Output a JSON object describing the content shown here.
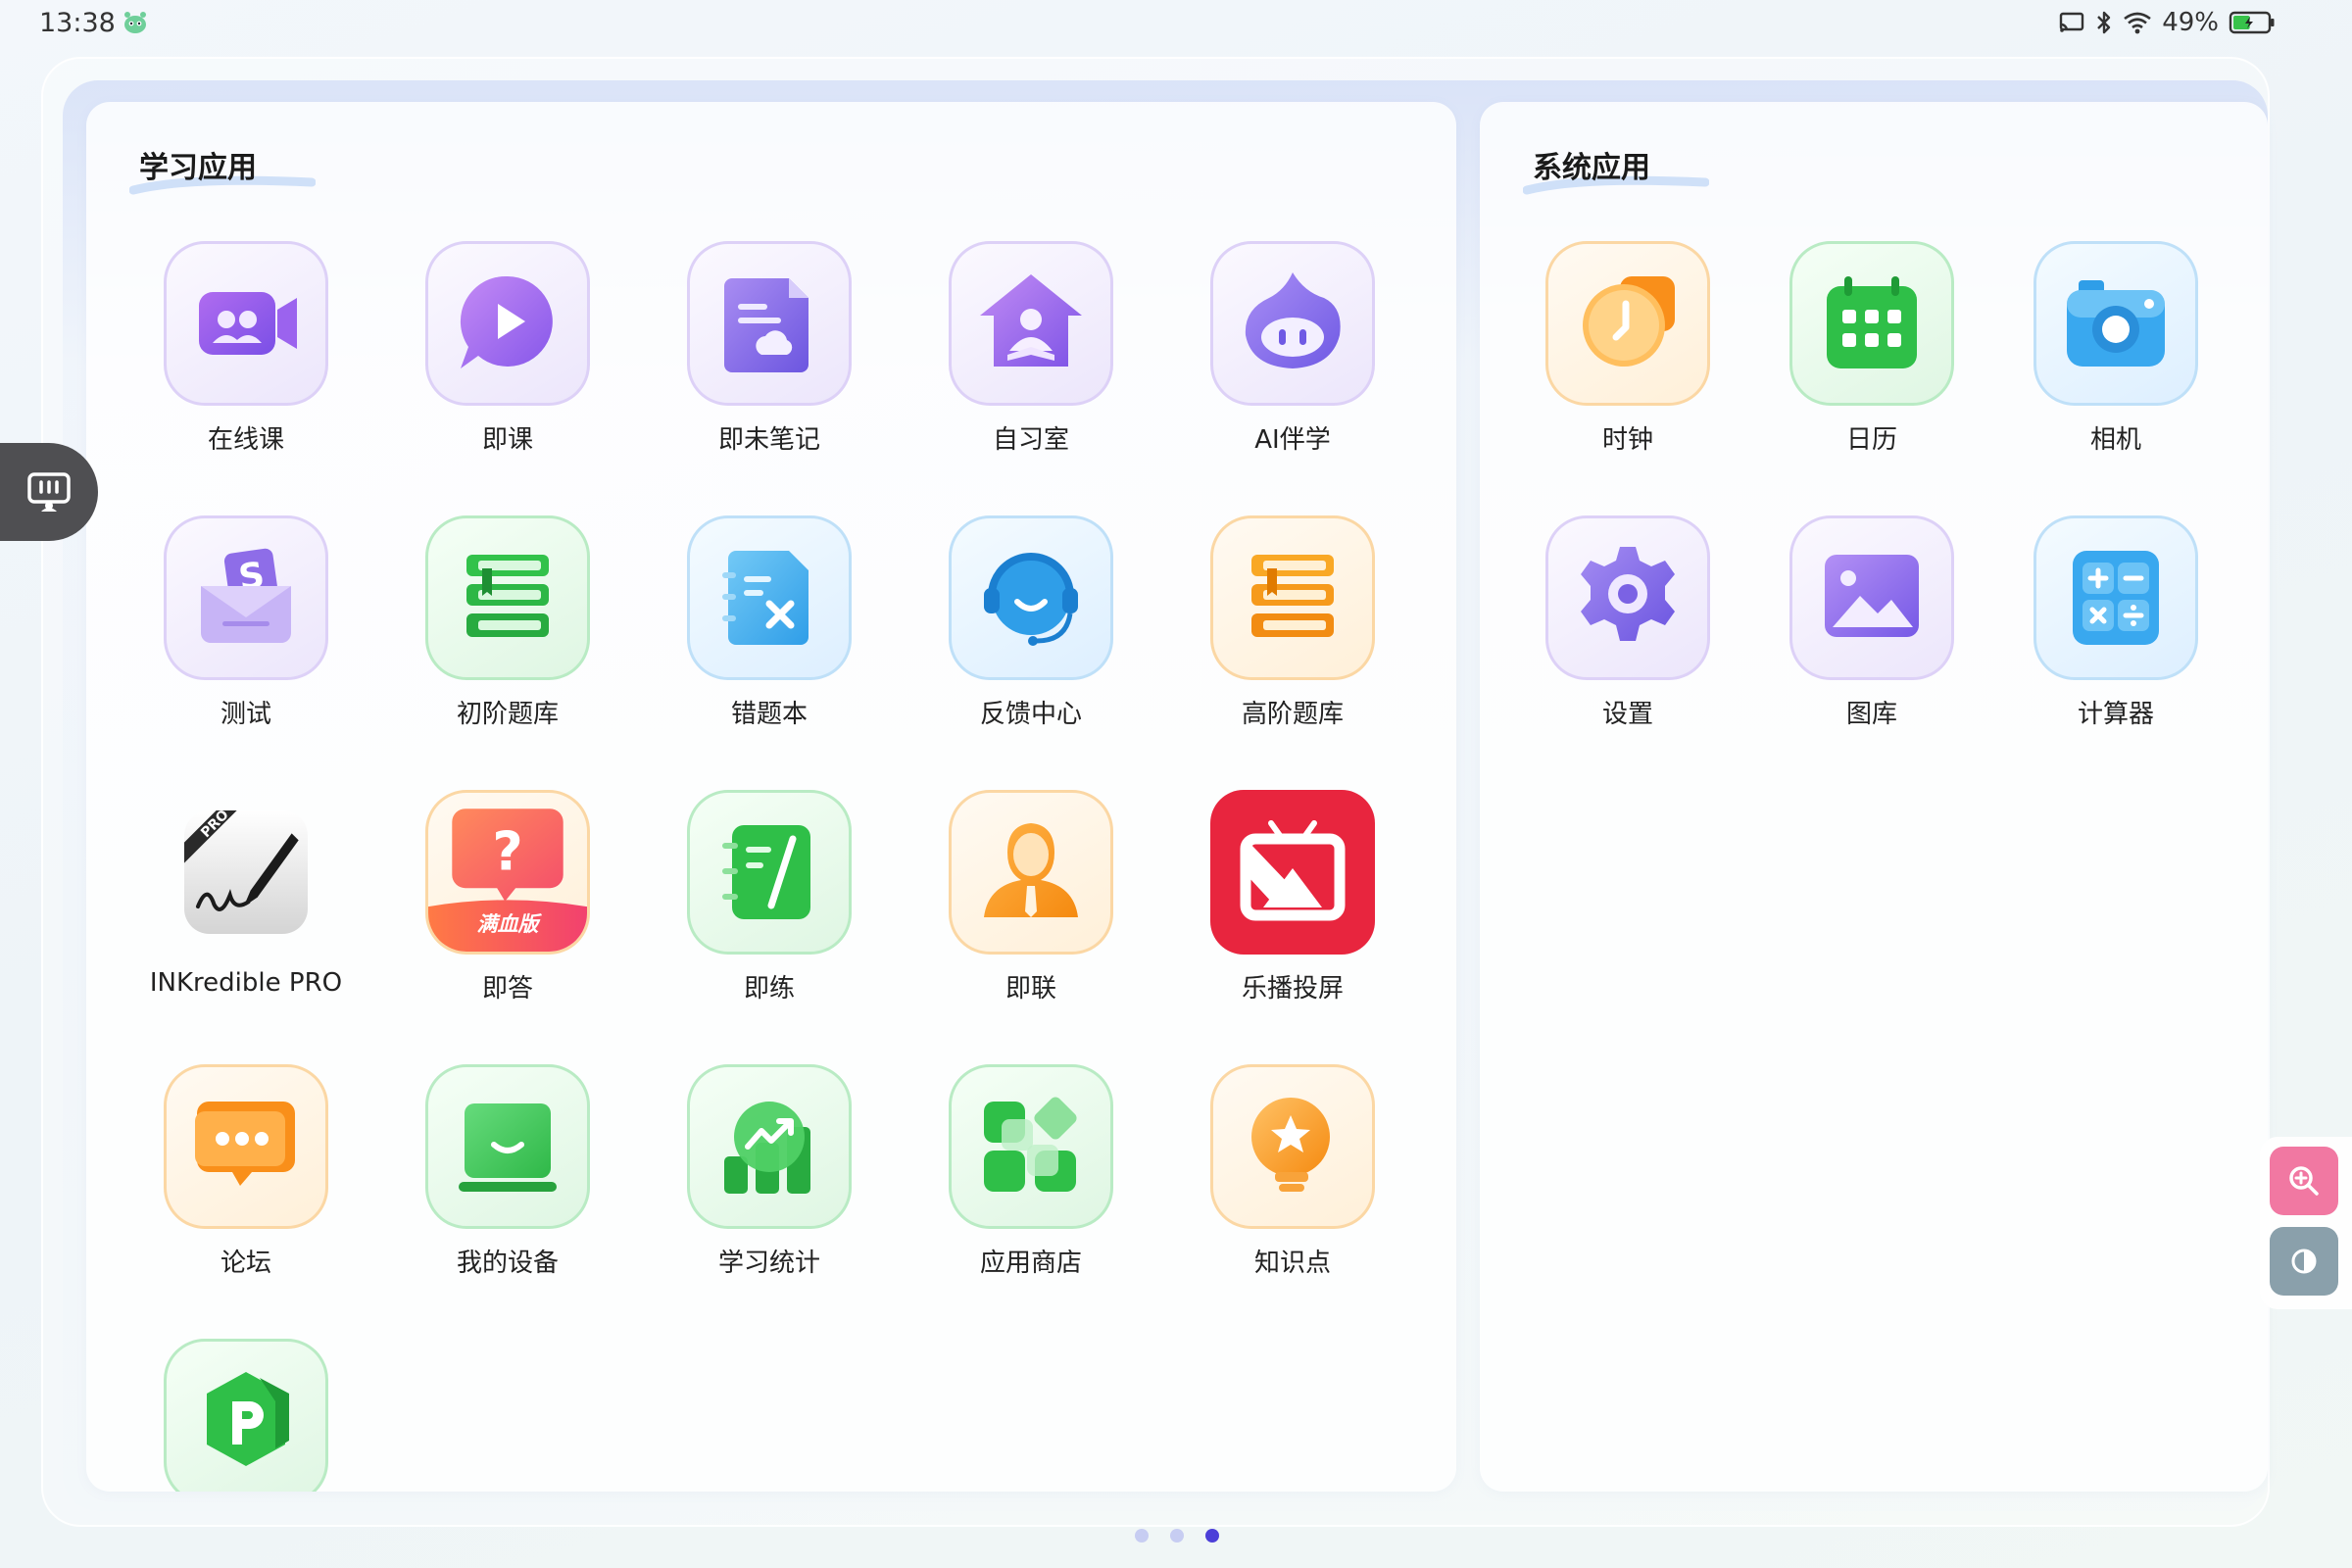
{
  "status_bar": {
    "time": "13:38",
    "battery_percent": "49%",
    "battery_level": 0.49,
    "icons": [
      "cast-icon",
      "bluetooth-icon",
      "wifi-icon",
      "battery-icon"
    ]
  },
  "learning_panel": {
    "title": "学习应用",
    "apps": [
      {
        "label": "在线课",
        "icon": "online-class-icon"
      },
      {
        "label": "即课",
        "icon": "play-course-icon"
      },
      {
        "label": "即未笔记",
        "icon": "notes-icon"
      },
      {
        "label": "自习室",
        "icon": "study-room-icon"
      },
      {
        "label": "AI伴学",
        "icon": "ai-companion-icon"
      },
      {
        "label": "测试",
        "icon": "test-icon"
      },
      {
        "label": "初阶题库",
        "icon": "basic-question-bank-icon"
      },
      {
        "label": "错题本",
        "icon": "mistake-book-icon"
      },
      {
        "label": "反馈中心",
        "icon": "feedback-headset-icon"
      },
      {
        "label": "高阶题库",
        "icon": "advanced-question-bank-icon"
      },
      {
        "label": "INKredible PRO",
        "icon": "inkredible-pen-icon",
        "badge": "PRO"
      },
      {
        "label": "即答",
        "icon": "question-answer-icon",
        "badge": "满血版"
      },
      {
        "label": "即练",
        "icon": "practice-icon"
      },
      {
        "label": "即联",
        "icon": "contact-person-icon"
      },
      {
        "label": "乐播投屏",
        "icon": "lebo-cast-icon"
      },
      {
        "label": "论坛",
        "icon": "forum-chat-icon"
      },
      {
        "label": "我的设备",
        "icon": "my-device-icon"
      },
      {
        "label": "学习统计",
        "icon": "study-stats-icon"
      },
      {
        "label": "应用商店",
        "icon": "app-store-icon"
      },
      {
        "label": "知识点",
        "icon": "knowledge-bulb-icon"
      },
      {
        "label": "",
        "icon": "p-app-icon"
      }
    ]
  },
  "system_panel": {
    "title": "系统应用",
    "apps": [
      {
        "label": "时钟",
        "icon": "clock-icon"
      },
      {
        "label": "日历",
        "icon": "calendar-icon"
      },
      {
        "label": "相机",
        "icon": "camera-icon"
      },
      {
        "label": "设置",
        "icon": "settings-gear-icon"
      },
      {
        "label": "图库",
        "icon": "gallery-icon"
      },
      {
        "label": "计算器",
        "icon": "calculator-icon"
      }
    ]
  },
  "side_widget": {
    "icon": "screen-tool-icon"
  },
  "right_tools": {
    "zoom_icon": "zoom-in-icon",
    "contrast_icon": "contrast-icon"
  },
  "pagination": {
    "total": 3,
    "current": 3
  }
}
